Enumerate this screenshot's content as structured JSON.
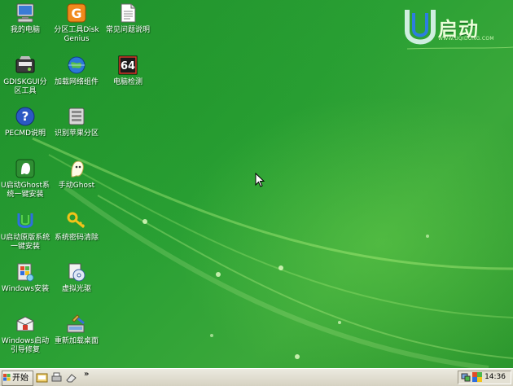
{
  "desktop": {
    "icons": [
      {
        "label": "我的电脑",
        "icon": "computer-icon"
      },
      {
        "label": "分区工具DiskGenius",
        "icon": "diskgenius-icon"
      },
      {
        "label": "常见问题说明",
        "icon": "document-icon"
      },
      {
        "label": "GDISKGUI分区工具",
        "icon": "partition-gui-icon"
      },
      {
        "label": "加载网络组件",
        "icon": "network-globe-icon"
      },
      {
        "label": "电脑检测",
        "icon": "cpu-64-icon"
      },
      {
        "label": "PECMD说明",
        "icon": "help-icon"
      },
      {
        "label": "识别苹果分区",
        "icon": "drive-icon"
      },
      {
        "label": "U启动Ghost系统一键安装",
        "icon": "ghost-install-icon"
      },
      {
        "label": "手动Ghost",
        "icon": "ghost-icon"
      },
      {
        "label": "U启动原版系统一键安装",
        "icon": "uqidong-install-icon"
      },
      {
        "label": "系统密码清除",
        "icon": "key-icon"
      },
      {
        "label": "Windows安装",
        "icon": "windows-setup-icon"
      },
      {
        "label": "虚拟光驱",
        "icon": "virtual-cdrom-icon"
      },
      {
        "label": "Windows启动引导修复",
        "icon": "boot-repair-icon"
      },
      {
        "label": "重新加载桌面",
        "icon": "reload-desktop-icon"
      }
    ]
  },
  "logo": {
    "text": "启动",
    "url": "WWW.UQIDONG.COM"
  },
  "taskbar": {
    "start_label": "开始",
    "overflow": "»",
    "clock": "14:36"
  },
  "colors": {
    "desktop_green": "#2aa034",
    "taskbar": "#e2dfd2"
  }
}
